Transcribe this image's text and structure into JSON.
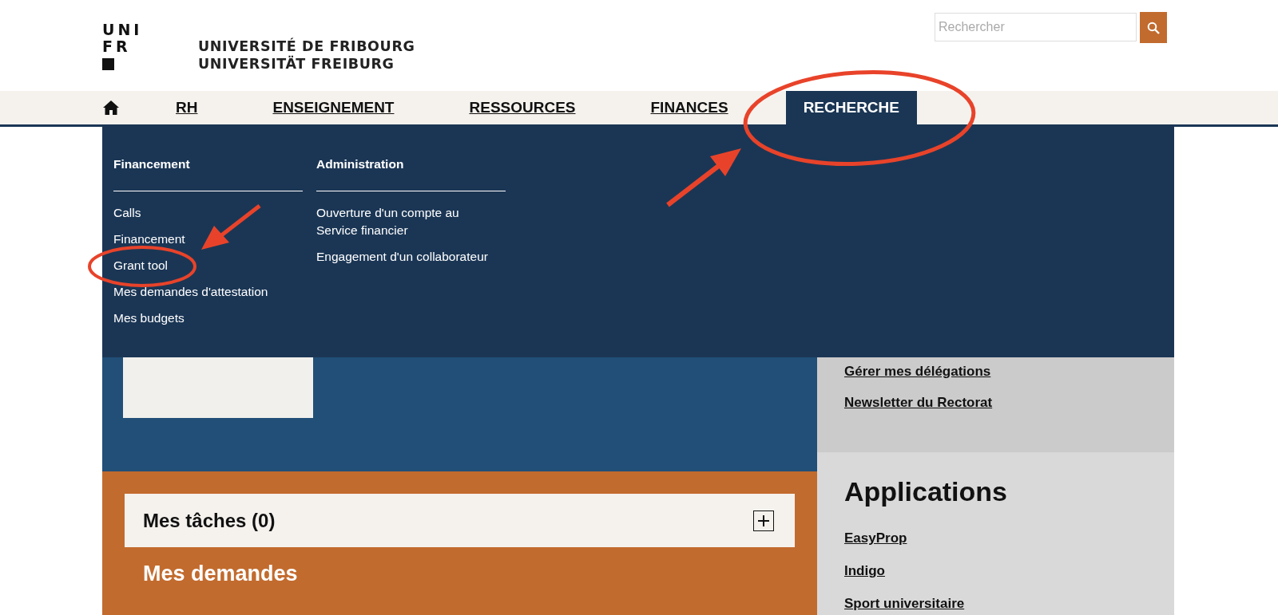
{
  "header": {
    "logo_lines": [
      "UNI",
      "FR"
    ],
    "university_names": [
      "UNIVERSITÉ DE FRIBOURG",
      "UNIVERSITÄT FREIBURG"
    ],
    "search": {
      "placeholder": "Rechercher"
    }
  },
  "nav": {
    "items": [
      {
        "label": "RH",
        "selected": false
      },
      {
        "label": "ENSEIGNEMENT",
        "selected": false
      },
      {
        "label": "RESSOURCES",
        "selected": false
      },
      {
        "label": "FINANCES",
        "selected": false
      },
      {
        "label": "RECHERCHE",
        "selected": true
      }
    ]
  },
  "mega_menu": {
    "columns": [
      {
        "heading": "Financement",
        "links": [
          "Calls",
          "Financement",
          "Grant tool",
          "Mes demandes d'attestation",
          "Mes budgets"
        ]
      },
      {
        "heading": "Administration",
        "links": [
          "Ouverture d'un compte au Service financier",
          "Engagement d'un collaborateur"
        ]
      }
    ]
  },
  "main": {
    "tasks": {
      "title": "Mes tâches (0)",
      "expanded": false
    },
    "requests_title": "Mes demandes"
  },
  "sidebar": {
    "top_links": [
      "Gérer mes délégations",
      "Newsletter du Rectorat"
    ],
    "applications": {
      "title": "Applications",
      "links": [
        "EasyProp",
        "Indigo",
        "Sport universitaire"
      ]
    }
  }
}
